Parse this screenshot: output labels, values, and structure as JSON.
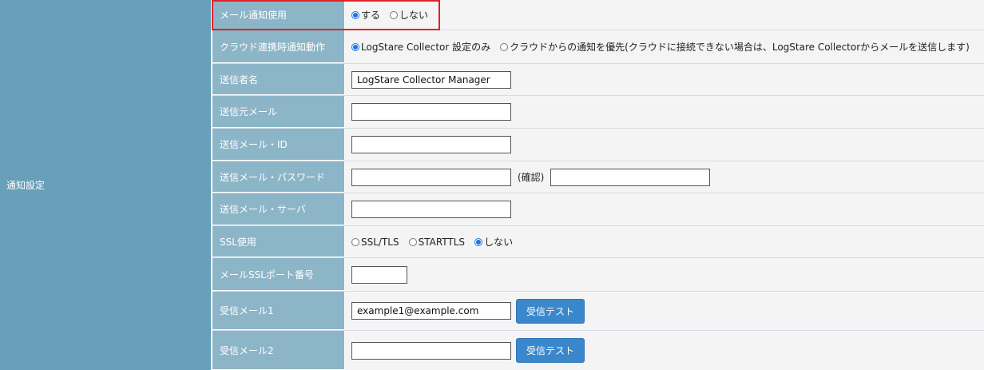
{
  "section_label": "通知設定",
  "rows": {
    "mail_notify": {
      "label": "メール通知使用",
      "options": [
        "する",
        "しない"
      ],
      "selected": "する"
    },
    "cloud_action": {
      "label": "クラウド連携時通知動作",
      "options": [
        "LogStare Collector 設定のみ",
        "クラウドからの通知を優先(クラウドに接続できない場合は、LogStare Collectorからメールを送信します)"
      ],
      "selected": "LogStare Collector 設定のみ"
    },
    "sender_name": {
      "label": "送信者名",
      "value": "LogStare Collector Manager"
    },
    "sender_mail": {
      "label": "送信元メール",
      "value": ""
    },
    "send_id": {
      "label": "送信メール・ID",
      "value": ""
    },
    "send_password": {
      "label": "送信メール・パスワード",
      "value": "",
      "confirm_label": "(確認)",
      "confirm_value": ""
    },
    "send_server": {
      "label": "送信メール・サーバ",
      "value": ""
    },
    "ssl": {
      "label": "SSL使用",
      "options": [
        "SSL/TLS",
        "STARTTLS",
        "しない"
      ],
      "selected": "しない"
    },
    "ssl_port": {
      "label": "メールSSLポート番号",
      "value": ""
    },
    "recv1": {
      "label": "受信メール1",
      "value": "example1@example.com",
      "button": "受信テスト"
    },
    "recv2": {
      "label": "受信メール2",
      "value": "",
      "button": "受信テスト"
    }
  }
}
